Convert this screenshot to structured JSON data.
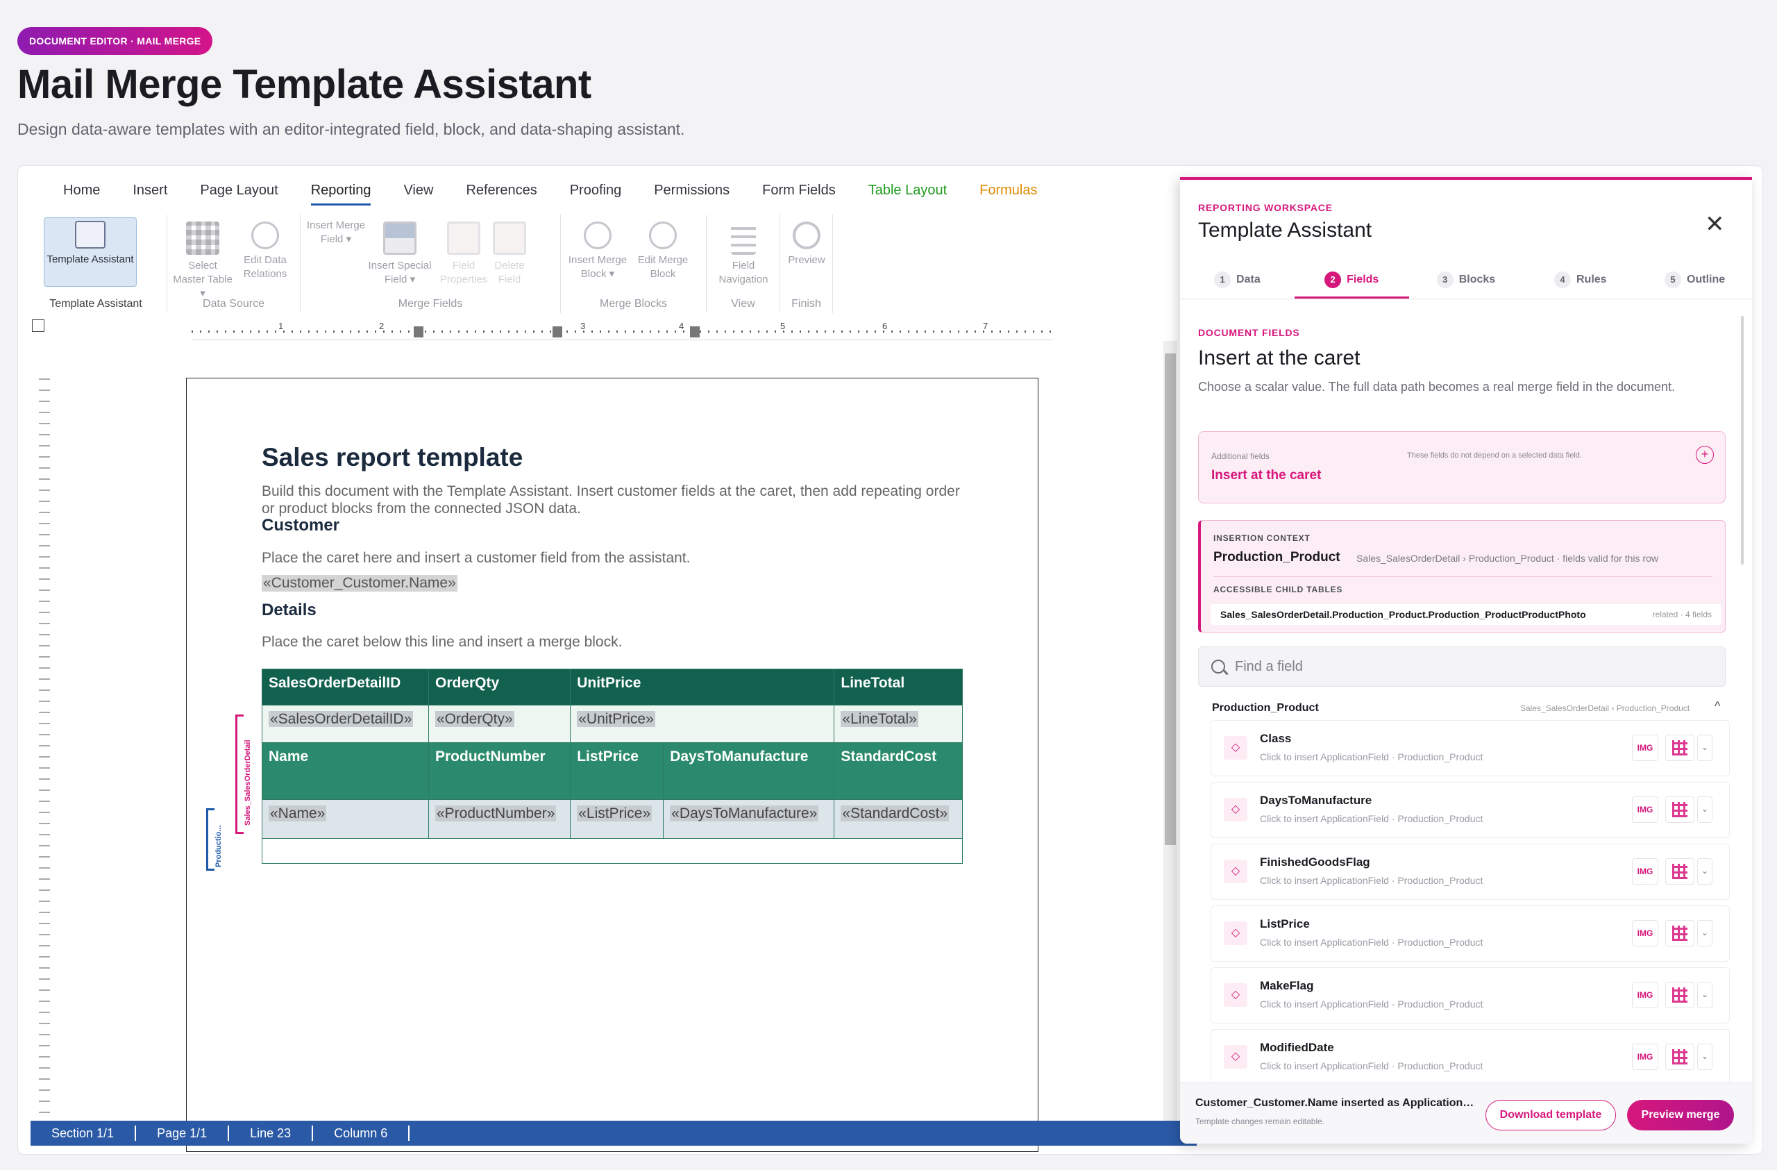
{
  "header": {
    "pill": "DOCUMENT EDITOR · MAIL MERGE",
    "title": "Mail Merge Template Assistant",
    "subtitle": "Design data-aware templates with an editor-integrated field, block, and data-shaping assistant."
  },
  "ribbon": {
    "tabs": [
      "Home",
      "Insert",
      "Page Layout",
      "Reporting",
      "View",
      "References",
      "Proofing",
      "Permissions",
      "Form Fields",
      "Table Layout",
      "Formulas"
    ],
    "active_tab": "Reporting",
    "groups": {
      "template_assistant": "Template Assistant",
      "data_source": "Data Source",
      "merge_fields": "Merge Fields",
      "merge_blocks": "Merge Blocks",
      "view": "View",
      "finish": "Finish"
    },
    "buttons": {
      "template_assistant": "Template Assistant",
      "select_master_table": "Select Master Table ▾",
      "edit_data_relations": "Edit Data Relations",
      "insert_merge_field": "Insert Merge Field ▾",
      "insert_special_field": "Insert Special Field ▾",
      "field_properties": "Field Properties",
      "delete_field": "Delete Field",
      "insert_merge_block": "Insert Merge Block ▾",
      "edit_merge_block": "Edit Merge Block",
      "field_navigation": "Field Navigation",
      "preview": "Preview"
    }
  },
  "ruler": {
    "numbers": [
      "1",
      "2",
      "3",
      "4",
      "5",
      "6",
      "7"
    ]
  },
  "document": {
    "title": "Sales report template",
    "intro": "Build this document with the Template Assistant. Insert customer fields at the caret, then add repeating order or product blocks from the connected JSON data.",
    "customer_heading": "Customer",
    "customer_text": "Place the caret here and insert a customer field from the assistant.",
    "customer_field": "«Customer_Customer.Name»",
    "details_heading": "Details",
    "details_text": "Place the caret below this line and insert a merge block.",
    "table": {
      "outer_headers": [
        "SalesOrderDetailID",
        "OrderQty",
        "UnitPrice",
        "LineTotal"
      ],
      "outer_fields": [
        "«SalesOrderDetailID»",
        "«OrderQty»",
        "«UnitPrice»",
        "«LineTotal»"
      ],
      "inner_headers": [
        "Name",
        "ProductNumber",
        "ListPrice",
        "DaysToManufacture",
        "StandardCost"
      ],
      "inner_fields": [
        "«Name»",
        "«ProductNumber»",
        "«ListPrice»",
        "«DaysToManufacture»",
        "«StandardCost»"
      ]
    },
    "block_labels": {
      "outer": "Sales_SalesOrderDetail",
      "inner": "Productio..."
    }
  },
  "status": {
    "section": "Section 1/1",
    "page": "Page 1/1",
    "line": "Line 23",
    "column": "Column 6"
  },
  "panel": {
    "eyebrow": "REPORTING WORKSPACE",
    "title": "Template Assistant",
    "close": "✕",
    "steps": [
      {
        "n": "1",
        "label": "Data"
      },
      {
        "n": "2",
        "label": "Fields"
      },
      {
        "n": "3",
        "label": "Blocks"
      },
      {
        "n": "4",
        "label": "Rules"
      },
      {
        "n": "5",
        "label": "Outline"
      }
    ],
    "active_step": "Fields",
    "section_eyebrow": "DOCUMENT FIELDS",
    "section_title": "Insert at the caret",
    "section_desc": "Choose a scalar value. The full data path becomes a real merge field in the document.",
    "additional": {
      "label": "Additional fields",
      "note": "These fields do not depend on a selected data field.",
      "title": "Insert at the caret",
      "plus": "+"
    },
    "context": {
      "label": "INSERTION CONTEXT",
      "table": "Production_Product",
      "path": "Sales_SalesOrderDetail › Production_Product · fields valid for this row",
      "child_label": "ACCESSIBLE CHILD TABLES",
      "child_name": "Sales_SalesOrderDetail.Production_Product.Production_ProductProductPhoto",
      "child_meta": "related · 4 fields"
    },
    "search_placeholder": "Find a field",
    "group": {
      "name": "Production_Product",
      "path": "Sales_SalesOrderDetail › Production_Product",
      "chevron": "^"
    },
    "img_label": "IMG",
    "field_sub": "Click to insert ApplicationField · Production_Product",
    "fields": [
      "Class",
      "DaysToManufacture",
      "FinishedGoodsFlag",
      "ListPrice",
      "MakeFlag",
      "ModifiedDate"
    ],
    "footer": {
      "message": "Customer_Customer.Name inserted as ApplicationField",
      "sub": "Template changes remain editable.",
      "download": "Download template",
      "preview": "Preview merge"
    }
  },
  "colors": {
    "accent": "#d6177c",
    "status_bar": "#2a5aa6",
    "table_header": "#12614f"
  }
}
